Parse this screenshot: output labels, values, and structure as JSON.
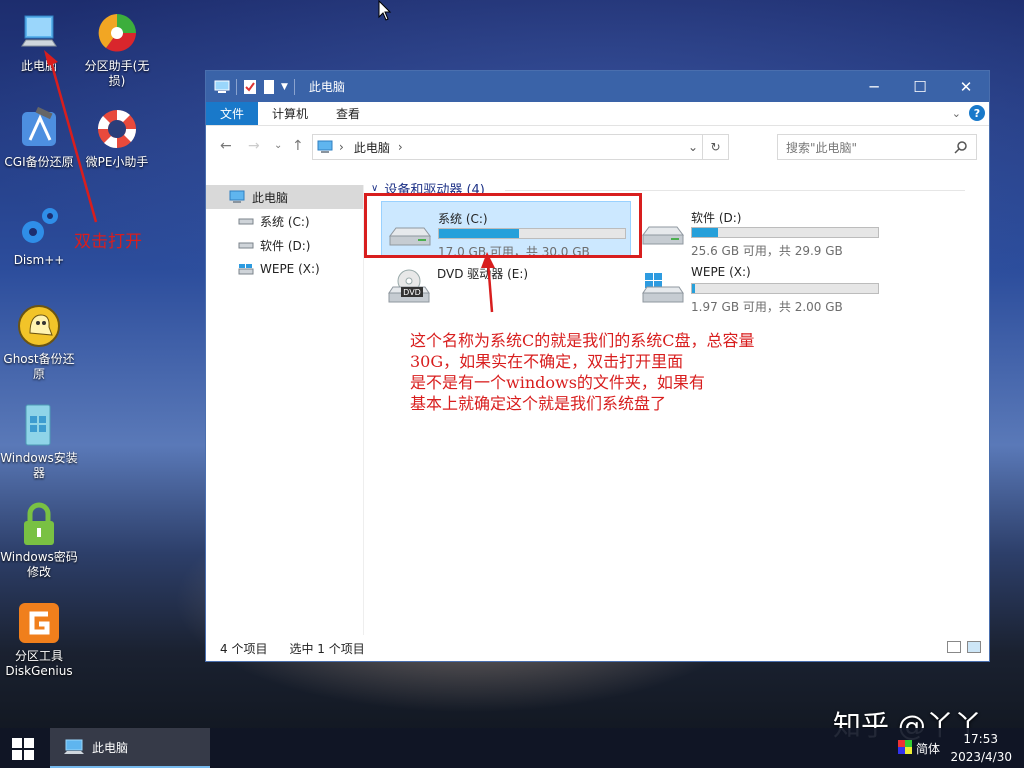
{
  "desktop": {
    "icons": [
      {
        "label": "此电脑"
      },
      {
        "label": "分区助手(无损)"
      },
      {
        "label": "CGI备份还原"
      },
      {
        "label": "微PE小助手"
      },
      {
        "label": "Dism++"
      },
      {
        "label": "Ghost备份还原"
      },
      {
        "label": "Windows安装器"
      },
      {
        "label": "Windows密码修改"
      },
      {
        "label": "分区工具DiskGenius"
      }
    ]
  },
  "window": {
    "title": "此电脑",
    "ribbon_tabs": [
      "文件",
      "计算机",
      "查看"
    ],
    "address_crumb": "此电脑",
    "search_placeholder": "搜索\"此电脑\"",
    "sidebar": [
      "此电脑",
      "系统 (C:)",
      "软件 (D:)",
      "WEPE (X:)"
    ],
    "group_header": "设备和驱动器 (4)",
    "drives": [
      {
        "name": "系统 (C:)",
        "size": "17.0 GB 可用，共 30.0 GB",
        "used_fraction": 0.43,
        "selected": true
      },
      {
        "name": "软件 (D:)",
        "size": "25.6 GB 可用，共 29.9 GB",
        "used_fraction": 0.14,
        "selected": false
      },
      {
        "name": "DVD 驱动器 (E:)",
        "size": "",
        "dvd_label": "DVD"
      },
      {
        "name": "WEPE (X:)",
        "size": "1.97 GB 可用，共 2.00 GB",
        "used_fraction": 0.015,
        "selected": false
      }
    ],
    "status": {
      "items": "4 个项目",
      "selected": "选中 1 个项目"
    }
  },
  "annotations": {
    "double_click": "双击打开",
    "note_lines": [
      "这个名称为系统C的就是我们的系统C盘，总容量",
      "30G，如果实在不确定，双击打开里面",
      "是不是有一个windows的文件夹，如果有",
      "基本上就确定这个就是我们系统盘了"
    ]
  },
  "taskbar": {
    "app": "此电脑",
    "ime": "简体",
    "time": "17:53",
    "date": "2023/4/30"
  },
  "watermark": "知乎 @丫丫",
  "colors": {
    "accent": "#1979ca",
    "titlebar": "#3a63a8",
    "annotation": "#d81e1e",
    "drive_fill": "#26a0da"
  }
}
